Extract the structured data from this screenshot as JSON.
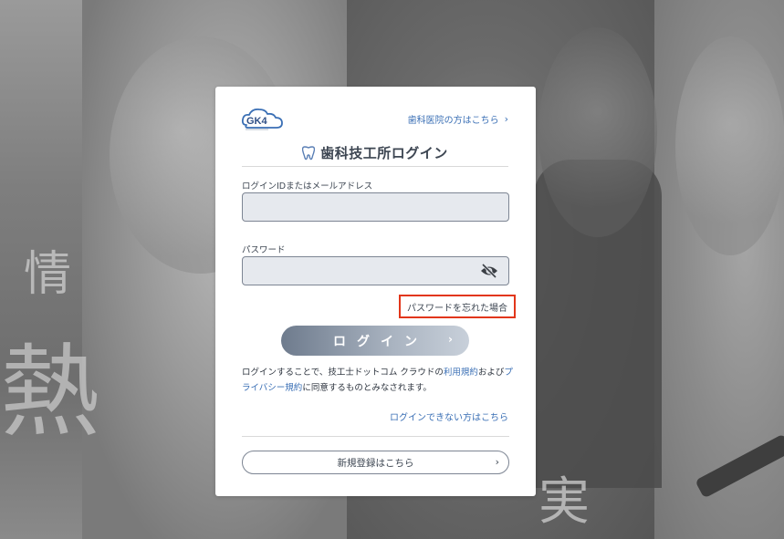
{
  "background": {
    "kanji": [
      "情",
      "熱",
      "実"
    ]
  },
  "header": {
    "logo_text": "GK4",
    "clinic_link": "歯科医院の方はこちら",
    "clinic_link_chevron": "›"
  },
  "title": {
    "icon": "tooth-icon",
    "text": "歯科技工所ログイン"
  },
  "form": {
    "id_label": "ログインIDまたはメールアドレス",
    "id_value": "",
    "password_label": "パスワード",
    "password_value": "",
    "password_toggle_icon": "eye-slash-icon",
    "forgot_password": "パスワードを忘れた場合"
  },
  "login_button": {
    "label": "ログイン",
    "arrow": "›"
  },
  "terms": {
    "part1": "ログインすることで、技工士ドットコム クラウドの",
    "link1": "利用規約",
    "part2": "および",
    "link2": "プライバシー規約",
    "part3": "に同意するものとみなされます。"
  },
  "cant_login": "ログインできない方はこちら",
  "register": {
    "label": "新規登録はこちら",
    "arrow": "›"
  },
  "colors": {
    "accent_link": "#3a6fb5",
    "highlight_border": "#e2361a",
    "button_gradient_start": "#6e7b8d"
  }
}
